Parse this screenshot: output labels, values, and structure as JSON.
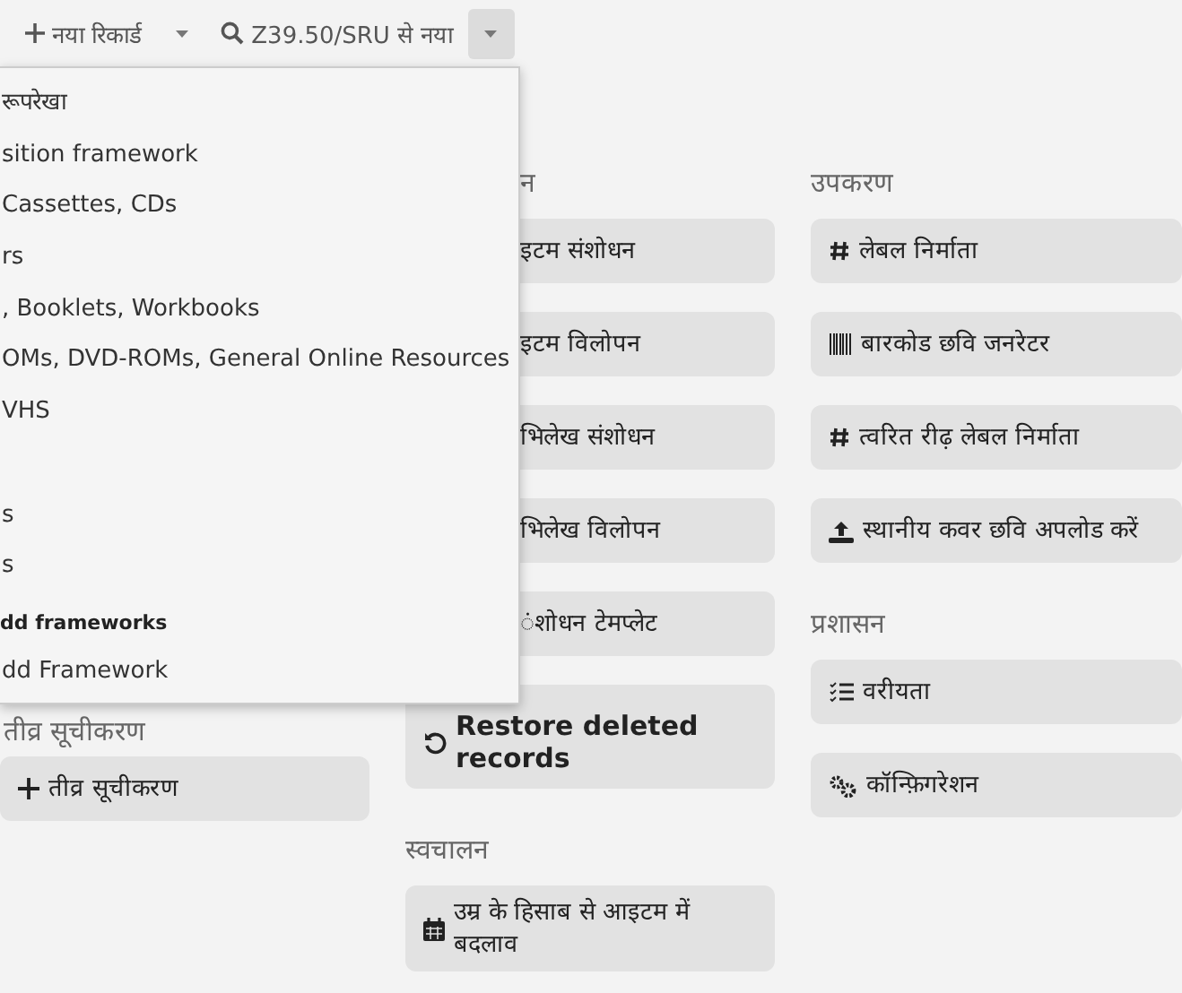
{
  "toolbar": {
    "new_record_button": {
      "label": "नया रिकार्ड"
    },
    "z3950_button": {
      "label": "Z39.50/SRU से नया"
    },
    "menu_toggle": {
      "expanded": true
    }
  },
  "menu": {
    "items": [
      {
        "kind": "item",
        "label": "रूपरेखा"
      },
      {
        "kind": "item",
        "label": "sition framework"
      },
      {
        "kind": "item",
        "label": "Cassettes, CDs"
      },
      {
        "kind": "item",
        "label": "rs"
      },
      {
        "kind": "item",
        "label": ", Booklets, Workbooks"
      },
      {
        "kind": "item",
        "label": "OMs, DVD-ROMs, General Online Resources"
      },
      {
        "kind": "item",
        "label": "VHS"
      },
      {
        "kind": "spacer"
      },
      {
        "kind": "item",
        "label": "s"
      },
      {
        "kind": "item",
        "label": "s"
      },
      {
        "kind": "header",
        "label": "dd frameworks"
      },
      {
        "kind": "item",
        "label": "dd Framework"
      }
    ]
  },
  "columns": [
    {
      "heading": "तीव्र सूचीकरण",
      "buttons": [
        {
          "label": "तीव्र सूचीकरण",
          "kind": "plus"
        }
      ]
    },
    {
      "heading": "न",
      "buttons": [
        {
          "label": "इटम संशोधन",
          "kind": "clipped"
        },
        {
          "label": "इटम विलोपन",
          "kind": "clipped"
        },
        {
          "label": "भिलेख संशोधन",
          "kind": "clipped"
        },
        {
          "label": "भिलेख विलोपन",
          "kind": "clipped"
        },
        {
          "label": "ंशोधन टेमप्लेट",
          "kind": "clipped"
        },
        {
          "label": "Restore deleted records",
          "kind": "restore"
        }
      ],
      "extra_heading": "स्वचालन",
      "extra_buttons": [
        {
          "label": "उम्र के हिसाब से आइटम में बदलाव",
          "kind": "calendar"
        }
      ]
    },
    {
      "heading": "उपकरण",
      "buttons": [
        {
          "label": "लेबल निर्माता",
          "kind": "hash"
        },
        {
          "label": "बारकोड छवि जनरेटर",
          "kind": "barcode"
        },
        {
          "label": "त्वरित रीढ़ लेबल निर्माता",
          "kind": "hash"
        },
        {
          "label": "स्थानीय कवर छवि अपलोड करें",
          "kind": "upload"
        }
      ],
      "extra_heading": "प्रशासन",
      "extra_buttons": [
        {
          "label": "वरीयता",
          "kind": "list"
        },
        {
          "label": "कॉन्फ़िगरेशन",
          "kind": "gears"
        }
      ]
    }
  ]
}
